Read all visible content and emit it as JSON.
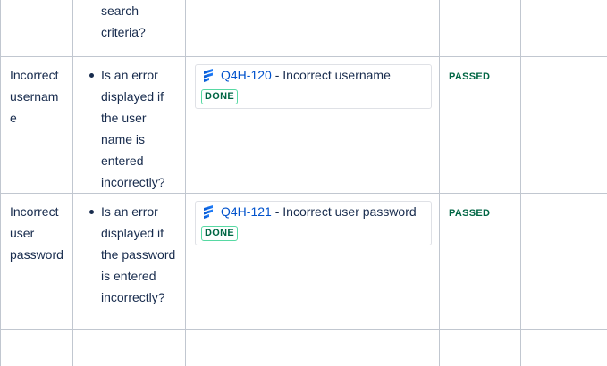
{
  "rows": [
    {
      "name": "",
      "check": "search criteria?",
      "issue": null,
      "result": ""
    },
    {
      "name": "Incorrect username",
      "check": "Is an error displayed if the user name is entered incorrectly?",
      "issue": {
        "key": "Q4H-120",
        "separator": " - ",
        "title": "Incorrect username",
        "status": "DONE",
        "icon": "jira-software-icon"
      },
      "result": "PASSED"
    },
    {
      "name": "Incorrect user password",
      "check": "Is an error displayed if the password is entered incorrectly?",
      "issue": {
        "key": "Q4H-121",
        "separator": " - ",
        "title": "Incorrect user password",
        "status": "DONE",
        "icon": "jira-software-icon"
      },
      "result": "PASSED"
    },
    {
      "name": "",
      "check": "",
      "issue": null,
      "result": ""
    }
  ],
  "colors": {
    "link": "#0052cc",
    "text": "#172b4d",
    "success": "#006644",
    "lozenge_border": "#57d9a3",
    "border": "#c1c7d0"
  }
}
